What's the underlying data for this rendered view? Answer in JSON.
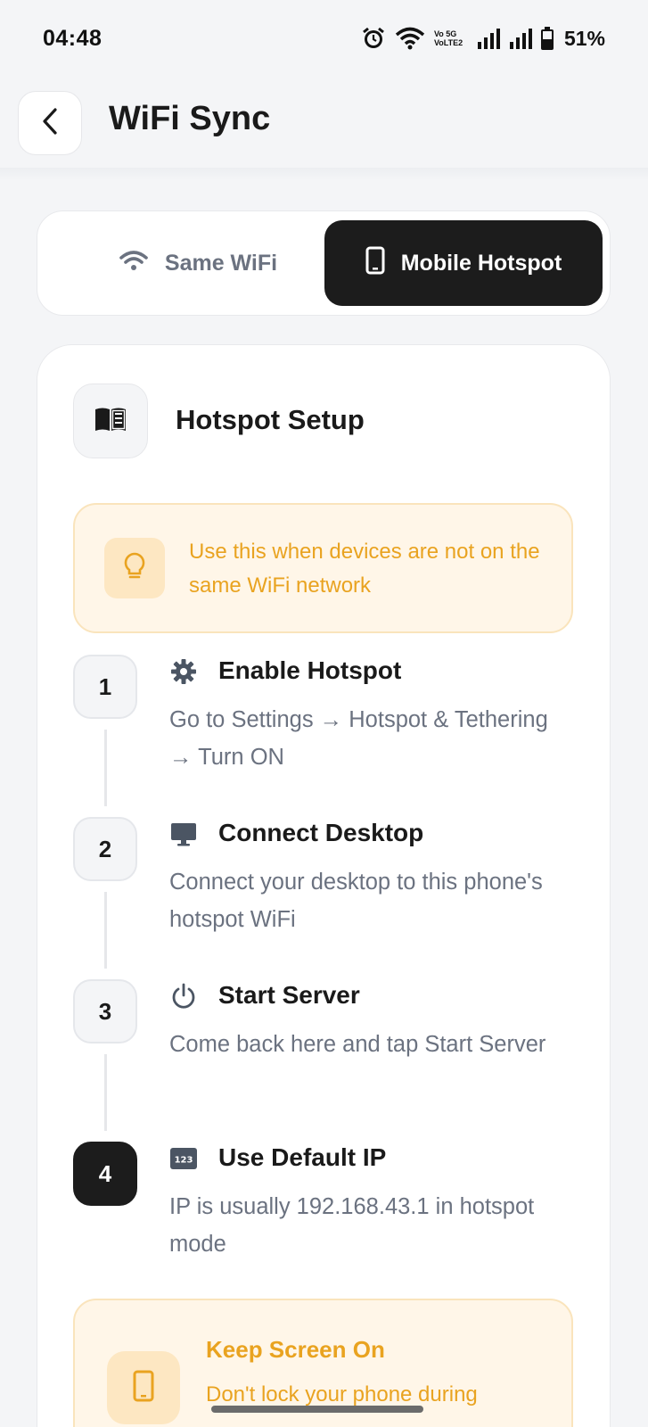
{
  "status_bar": {
    "time": "04:48",
    "network_label": "Vo 5G\nVoLTE2",
    "battery": "51%",
    "icons": [
      "alarm-icon",
      "wifi-icon",
      "volte-icon",
      "signal-icon",
      "signal-icon",
      "battery-icon"
    ]
  },
  "header": {
    "title": "WiFi Sync",
    "back_icon": "chevron-left-icon"
  },
  "tabs": [
    {
      "label": "Same WiFi",
      "icon": "wifi-icon",
      "selected": false
    },
    {
      "label": "Mobile Hotspot",
      "icon": "phone-icon",
      "selected": true
    }
  ],
  "card": {
    "title": "Hotspot Setup",
    "icon": "book-icon",
    "info": {
      "icon": "lightbulb-icon",
      "text": "Use this when devices are not on the same WiFi network"
    },
    "steps": [
      {
        "number": "1",
        "icon": "gear-icon",
        "title": "Enable Hotspot",
        "description": "Go to Settings → Hotspot & Tethering → Turn ON"
      },
      {
        "number": "2",
        "icon": "monitor-icon",
        "title": "Connect Desktop",
        "description": "Connect your desktop to this phone's hotspot WiFi"
      },
      {
        "number": "3",
        "icon": "power-icon",
        "title": "Start Server",
        "description": "Come back here and tap Start Server"
      },
      {
        "number": "4",
        "icon": "numbers-123-icon",
        "title": "Use Default IP",
        "description": "IP is usually 192.168.43.1 in hotspot mode"
      }
    ],
    "warning": {
      "icon": "phone-icon",
      "title": "Keep Screen On",
      "text": "Don't lock your phone during"
    }
  },
  "colors": {
    "accent_dark": "#1c1c1c",
    "warning_text": "#e9a320",
    "warning_bg": "#fff6e8",
    "muted_text": "#6b7280"
  }
}
